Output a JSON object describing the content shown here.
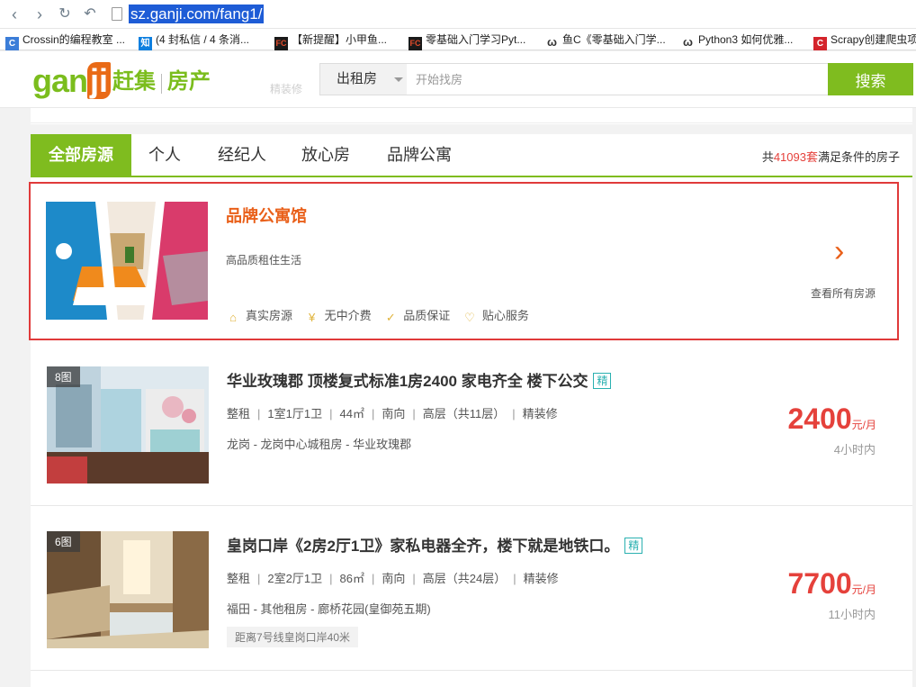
{
  "browser": {
    "url": "sz.ganji.com/fang1/",
    "bookmarks": [
      {
        "icon_text": "C",
        "icon_color": "#3b7dd8",
        "label": "Crossin的编程教室 ..."
      },
      {
        "icon_text": "知",
        "icon_color": "#0e7fdf",
        "label": "(4 封私信 / 4 条消..."
      },
      {
        "icon_text": "FC",
        "icon_color": "#333333",
        "label": "【新提醒】小甲鱼..."
      },
      {
        "icon_text": "FC",
        "icon_color": "#333333",
        "label": "零基础入门学习Pyt..."
      },
      {
        "icon_text": "ω",
        "icon_color": "#ffffff",
        "label": "鱼C《零基础入门学..."
      },
      {
        "icon_text": "ω",
        "icon_color": "#ffffff",
        "label": "Python3 如何优雅..."
      },
      {
        "icon_text": "C",
        "icon_color": "#d4242b",
        "label": "Scrapy创建爬虫项"
      }
    ]
  },
  "header": {
    "logo_latin_1": "gan",
    "logo_latin_2": "ji",
    "logo_cn": "赶集",
    "logo_category": "房产",
    "ghost_text": "精装修",
    "search_type": "出租房",
    "search_placeholder": "开始找房",
    "search_button": "搜索"
  },
  "tabs": {
    "items": [
      "全部房源",
      "个人",
      "经纪人",
      "放心房",
      "品牌公寓"
    ],
    "count_prefix": "共",
    "count_number": "41093套",
    "count_suffix": "满足条件的房子"
  },
  "featured": {
    "title": "品牌公寓馆",
    "subtitle": "高品质租住生活",
    "badges": [
      {
        "icon": "home-icon",
        "glyph": "⌂",
        "label": "真实房源"
      },
      {
        "icon": "yen-icon",
        "glyph": "¥",
        "label": "无中介费"
      },
      {
        "icon": "shield-icon",
        "glyph": "✓",
        "label": "品质保证"
      },
      {
        "icon": "heart-icon",
        "glyph": "♡",
        "label": "贴心服务"
      }
    ],
    "more_label": "查看所有房源"
  },
  "listings": [
    {
      "photo_count": "8图",
      "title": "华业玫瑰郡 顶楼复式标准1房2400 家电齐全 楼下公交",
      "badge": "精",
      "attrs": [
        "整租",
        "1室1厅1卫",
        "44㎡",
        "南向",
        "高层（共11层）",
        "精装修"
      ],
      "location": "龙岗 - 龙岗中心城租房 - 华业玫瑰郡",
      "subway": "",
      "price": "2400",
      "price_unit": "元/月",
      "time": "4小时内"
    },
    {
      "photo_count": "6图",
      "title": "皇岗口岸《2房2厅1卫》家私电器全齐，楼下就是地铁口。",
      "badge": "精",
      "attrs": [
        "整租",
        "2室2厅1卫",
        "86㎡",
        "南向",
        "高层（共24层）",
        "精装修"
      ],
      "location": "福田 - 其他租房 - 廊桥花园(皇御苑五期)",
      "subway": "距离7号线皇岗口岸40米",
      "price": "7700",
      "price_unit": "元/月",
      "time": "11小时内"
    }
  ]
}
